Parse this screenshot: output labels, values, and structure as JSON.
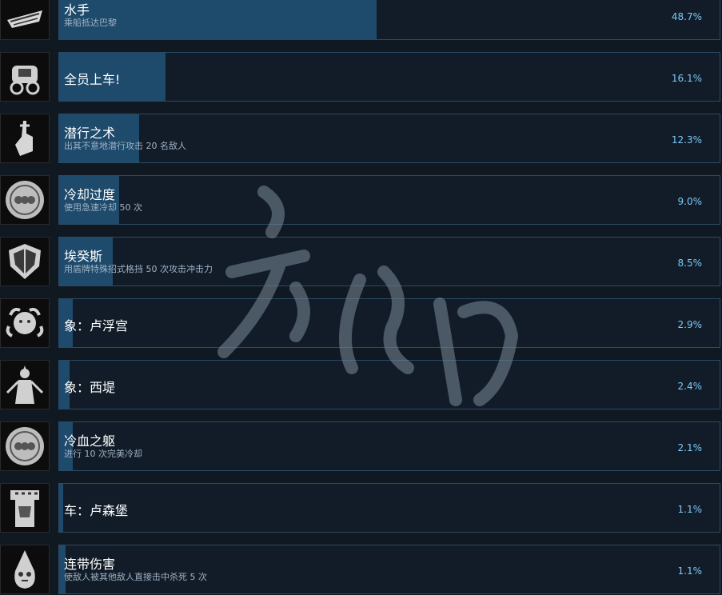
{
  "achievements": [
    {
      "icon": "boat-icon",
      "title": "水手",
      "description": "乘船抵达巴黎",
      "percent": "48.7%",
      "fraction": 0.487
    },
    {
      "icon": "carriage-icon",
      "title": "全员上车!",
      "description": "",
      "percent": "16.1%",
      "fraction": 0.161
    },
    {
      "icon": "silence-hand-icon",
      "title": "潜行之术",
      "description": "出其不意地潜行攻击 20 名敌人",
      "percent": "12.3%",
      "fraction": 0.123
    },
    {
      "icon": "medallion-icon",
      "title": "冷却过度",
      "description": "使用急速冷却 50 次",
      "percent": "9.0%",
      "fraction": 0.09
    },
    {
      "icon": "shield-icon",
      "title": "埃癸斯",
      "description": "用盾牌特殊招式格挡 50 次攻击冲击力",
      "percent": "8.5%",
      "fraction": 0.085
    },
    {
      "icon": "medusa-head-icon",
      "title": "象：卢浮宫",
      "description": "",
      "percent": "2.9%",
      "fraction": 0.029
    },
    {
      "icon": "statue-figure-icon",
      "title": "象：西堤",
      "description": "",
      "percent": "2.4%",
      "fraction": 0.024
    },
    {
      "icon": "medallion-icon",
      "title": "冷血之躯",
      "description": "进行 10 次完美冷却",
      "percent": "2.1%",
      "fraction": 0.021
    },
    {
      "icon": "tower-icon",
      "title": "车：卢森堡",
      "description": "",
      "percent": "1.1%",
      "fraction": 0.011
    },
    {
      "icon": "hooded-ghost-icon",
      "title": "连带伤害",
      "description": "使敌人被其他敌人直接击中杀死 5 次",
      "percent": "1.1%",
      "fraction": 0.011
    }
  ],
  "colors": {
    "background": "#101822",
    "bar_bg": "#121c28",
    "bar_fill": "#1e4a6b",
    "bar_border": "#2b4a63",
    "percent_text": "#7cc8f5",
    "desc_text": "#9fb2c4"
  }
}
